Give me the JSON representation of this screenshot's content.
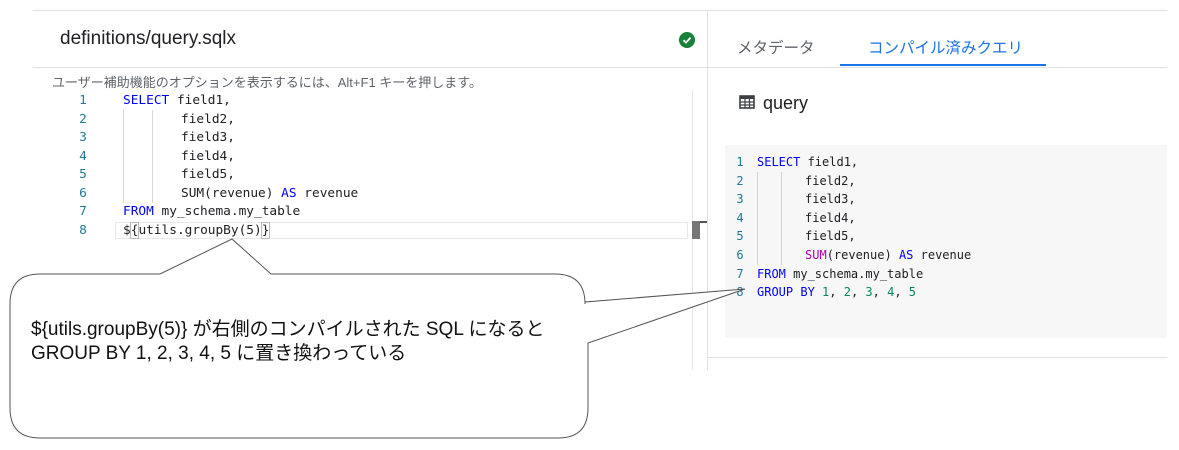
{
  "editor": {
    "file_title": "definitions/query.sqlx",
    "status_icon": "check-circle-icon",
    "a11y_hint": "ユーザー補助機能のオプションを表示するには、Alt+F1 キーを押します。",
    "lines": [
      {
        "num": "1",
        "kw": "SELECT",
        "rest": " field1,"
      },
      {
        "num": "2",
        "code": "field2,"
      },
      {
        "num": "3",
        "code": "field3,"
      },
      {
        "num": "4",
        "code": "field4,"
      },
      {
        "num": "5",
        "code": "field5,"
      },
      {
        "num": "6",
        "pre": "SUM(revenue) ",
        "kw": "AS",
        "post": " revenue"
      },
      {
        "num": "7",
        "kw": "FROM",
        "rest": " my_schema.my_table"
      },
      {
        "num": "8",
        "p1": "$",
        "b1": "{",
        "mid": "utils.groupBy(5)",
        "b2": "}"
      }
    ]
  },
  "right_pane": {
    "tabs": [
      {
        "label": "メタデータ",
        "active": false
      },
      {
        "label": "コンパイル済みクエリ",
        "active": true
      }
    ],
    "accent_color": "#1a73e8",
    "query_icon": "table-icon",
    "query_title": "query",
    "compiled_lines": [
      {
        "num": "1",
        "kw": "SELECT",
        "rest": " field1,"
      },
      {
        "num": "2",
        "code": "field2,"
      },
      {
        "num": "3",
        "code": "field3,"
      },
      {
        "num": "4",
        "code": "field4,"
      },
      {
        "num": "5",
        "code": "field5,"
      },
      {
        "num": "6",
        "fn": "SUM",
        "mid": "(revenue) ",
        "kw": "AS",
        "post": " revenue"
      },
      {
        "num": "7",
        "kw": "FROM",
        "rest": " my_schema.my_table"
      },
      {
        "num": "8",
        "kw": "GROUP BY",
        "n1": "1",
        "n2": "2",
        "n3": "3",
        "n4": "4",
        "n5": "5"
      }
    ]
  },
  "callout": {
    "text": "${utils.groupBy(5)} が右側のコンパイルされた SQL になると GROUP BY 1, 2, 3, 4, 5 に置き換わっている"
  }
}
